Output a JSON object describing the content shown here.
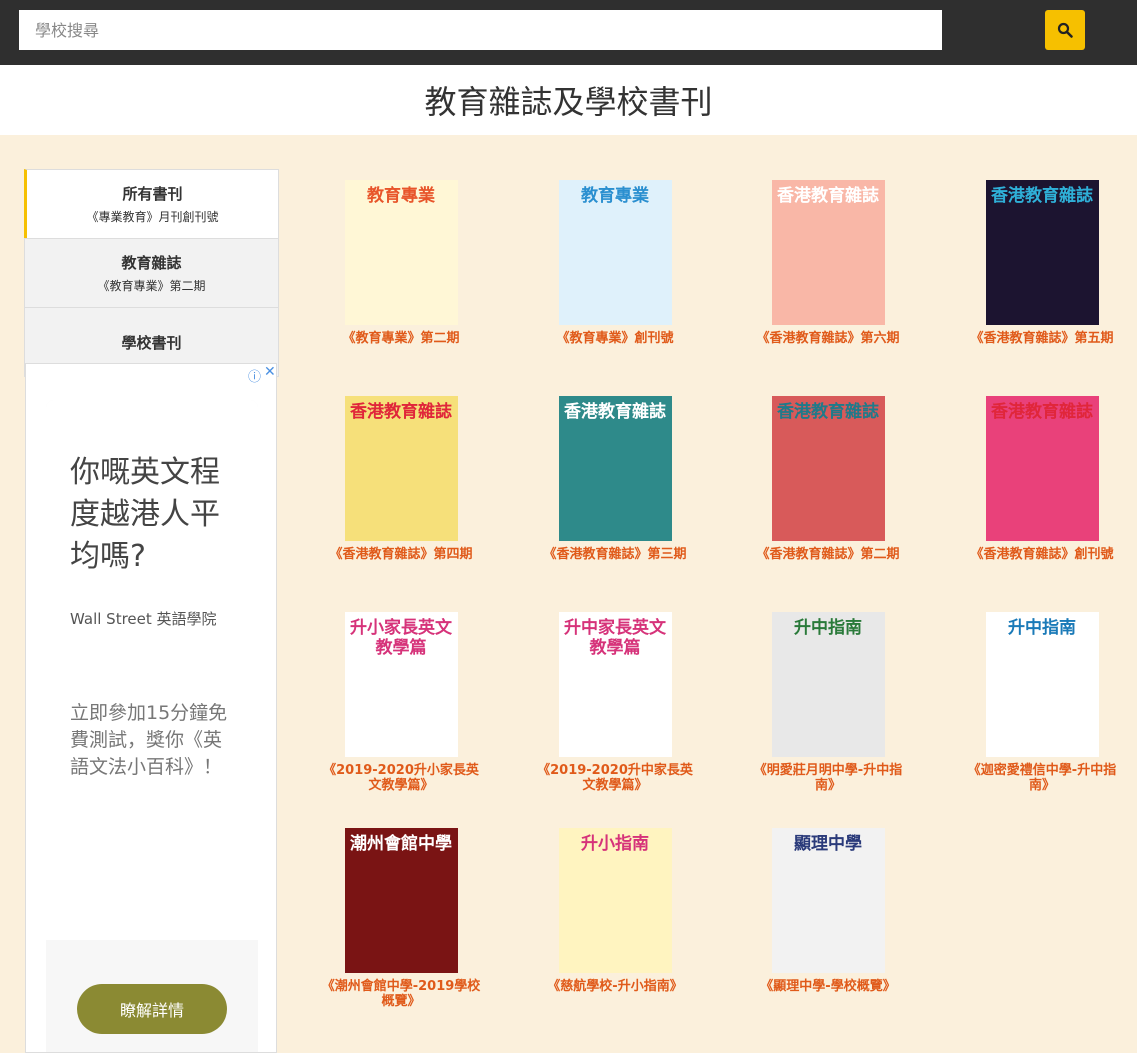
{
  "search": {
    "placeholder": "學校搜尋",
    "button_icon": "search-icon"
  },
  "page_title": "教育雜誌及學校書刊",
  "sidebar": {
    "items": [
      {
        "title": "所有書刊",
        "subtitle": "《專業教育》月刊創刊號",
        "active": true
      },
      {
        "title": "教育雜誌",
        "subtitle": "《教育專業》第二期",
        "active": false
      },
      {
        "title": "學校書刊",
        "subtitle": "",
        "active": false
      }
    ]
  },
  "ad": {
    "info_icon": "ⓘ",
    "close_icon": "✕",
    "headline": "你嘅英文程度越港人平均嗎?",
    "brand": "Wall Street 英語學院",
    "body": "立即參加15分鐘免費測試，獎你《英語文法小百科》！",
    "cta": "瞭解詳情"
  },
  "covers": [
    {
      "caption": "《教育專業》第二期",
      "cover_text": "教育專業",
      "bg": "#fff7d6",
      "fg": "#e8552a"
    },
    {
      "caption": "《教育專業》創刊號",
      "cover_text": "教育專業",
      "bg": "#dff1fb",
      "fg": "#2a8fd0"
    },
    {
      "caption": "《香港教育雜誌》第六期",
      "cover_text": "香港教育雜誌",
      "bg": "#f9b7a7",
      "fg": "#ffffff"
    },
    {
      "caption": "《香港教育雜誌》第五期",
      "cover_text": "香港教育雜誌",
      "bg": "#1c1430",
      "fg": "#2fb0d8"
    },
    {
      "caption": "《香港教育雜誌》第四期",
      "cover_text": "香港教育雜誌",
      "bg": "#f6e07a",
      "fg": "#e0263a"
    },
    {
      "caption": "《香港教育雜誌》第三期",
      "cover_text": "香港教育雜誌",
      "bg": "#2e8a8a",
      "fg": "#ffffff"
    },
    {
      "caption": "《香港教育雜誌》第二期",
      "cover_text": "香港教育雜誌",
      "bg": "#d85a5a",
      "fg": "#1f7a8a"
    },
    {
      "caption": "《香港教育雜誌》創刊號",
      "cover_text": "香港教育雜誌",
      "bg": "#e9417a",
      "fg": "#e0263a"
    },
    {
      "caption": "《2019-2020升小家長英文教學篇》",
      "cover_text": "升小家長英文教學篇",
      "bg": "#ffffff",
      "fg": "#d6337a"
    },
    {
      "caption": "《2019-2020升中家長英文教學篇》",
      "cover_text": "升中家長英文教學篇",
      "bg": "#ffffff",
      "fg": "#d6337a"
    },
    {
      "caption": "《明愛莊月明中學-升中指南》",
      "cover_text": "升中指南",
      "bg": "#e8e8e8",
      "fg": "#2a7a3a"
    },
    {
      "caption": "《迦密愛禮信中學-升中指南》",
      "cover_text": "升中指南",
      "bg": "#ffffff",
      "fg": "#1a7ab8"
    },
    {
      "caption": "《潮州會館中學-2019學校概覽》",
      "cover_text": "潮州會館中學",
      "bg": "#7a1414",
      "fg": "#ffffff"
    },
    {
      "caption": "《慈航學校-升小指南》",
      "cover_text": "升小指南",
      "bg": "#fff4c0",
      "fg": "#d6337a"
    },
    {
      "caption": "《顯理中學-學校概覽》",
      "cover_text": "顯理中學",
      "bg": "#f2f2f2",
      "fg": "#2a3a7a"
    }
  ]
}
